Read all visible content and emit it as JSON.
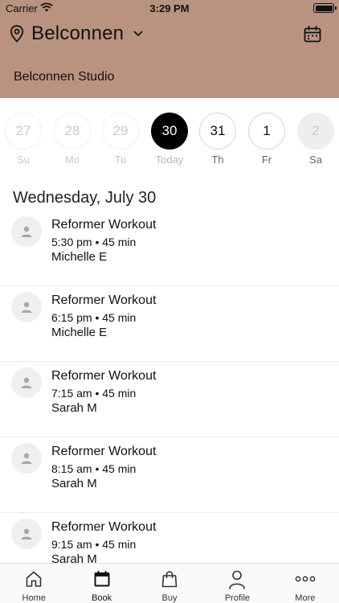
{
  "status_bar": {
    "carrier": "Carrier",
    "time": "3:29 PM"
  },
  "header": {
    "location": "Belconnen",
    "studio": "Belconnen Studio",
    "bg_color": "#b99380",
    "icons": {
      "location": "map-pin-icon",
      "dropdown": "chevron-down-icon",
      "calendar": "calendar-icon"
    }
  },
  "week": [
    {
      "day": "27",
      "label": "Su",
      "state": "past"
    },
    {
      "day": "28",
      "label": "Mo",
      "state": "past"
    },
    {
      "day": "29",
      "label": "Tu",
      "state": "past"
    },
    {
      "day": "30",
      "label": "Today",
      "state": "today"
    },
    {
      "day": "31",
      "label": "Th",
      "state": "future"
    },
    {
      "day": "1",
      "label": "Fr",
      "state": "future"
    },
    {
      "day": "2",
      "label": "Sa",
      "state": "disabled"
    }
  ],
  "date_heading": "Wednesday, July 30",
  "classes": [
    {
      "title": "Reformer Workout",
      "time": "5:30 pm • 45 min",
      "instructor": "Michelle E"
    },
    {
      "title": "Reformer Workout",
      "time": "6:15 pm • 45 min",
      "instructor": "Michelle E"
    },
    {
      "title": "Reformer Workout",
      "time": "7:15 am • 45 min",
      "instructor": "Sarah M"
    },
    {
      "title": "Reformer Workout",
      "time": "8:15 am • 45 min",
      "instructor": "Sarah M"
    },
    {
      "title": "Reformer Workout",
      "time": "9:15 am • 45 min",
      "instructor": "Sarah M"
    }
  ],
  "tabs": [
    {
      "label": "Home",
      "icon": "home-icon",
      "active": false
    },
    {
      "label": "Book",
      "icon": "book-calendar-icon",
      "active": true
    },
    {
      "label": "Buy",
      "icon": "shopping-bag-icon",
      "active": false
    },
    {
      "label": "Profile",
      "icon": "person-icon",
      "active": false
    },
    {
      "label": "More",
      "icon": "more-dots-icon",
      "active": false
    }
  ]
}
